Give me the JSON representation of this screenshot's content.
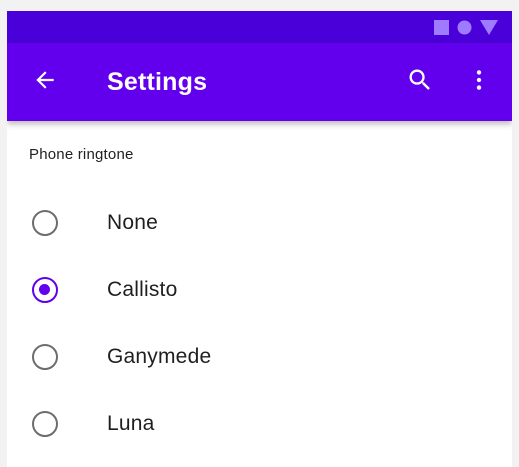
{
  "app_bar": {
    "title": "Settings"
  },
  "icons": {
    "status": [
      "square-icon",
      "circle-icon",
      "triangle-icon"
    ],
    "back": "arrow-back-icon",
    "search": "search-icon",
    "more": "more-vert-icon"
  },
  "colors": {
    "status_bar": "#4a00d8",
    "app_bar": "#6200ee",
    "accent": "#6200ee",
    "unselected_radio": "#6d6d6d"
  },
  "ringtone": {
    "header": "Phone ringtone",
    "selected": "Callisto",
    "options": [
      {
        "label": "None",
        "selected": false
      },
      {
        "label": "Callisto",
        "selected": true
      },
      {
        "label": "Ganymede",
        "selected": false
      },
      {
        "label": "Luna",
        "selected": false
      }
    ]
  }
}
